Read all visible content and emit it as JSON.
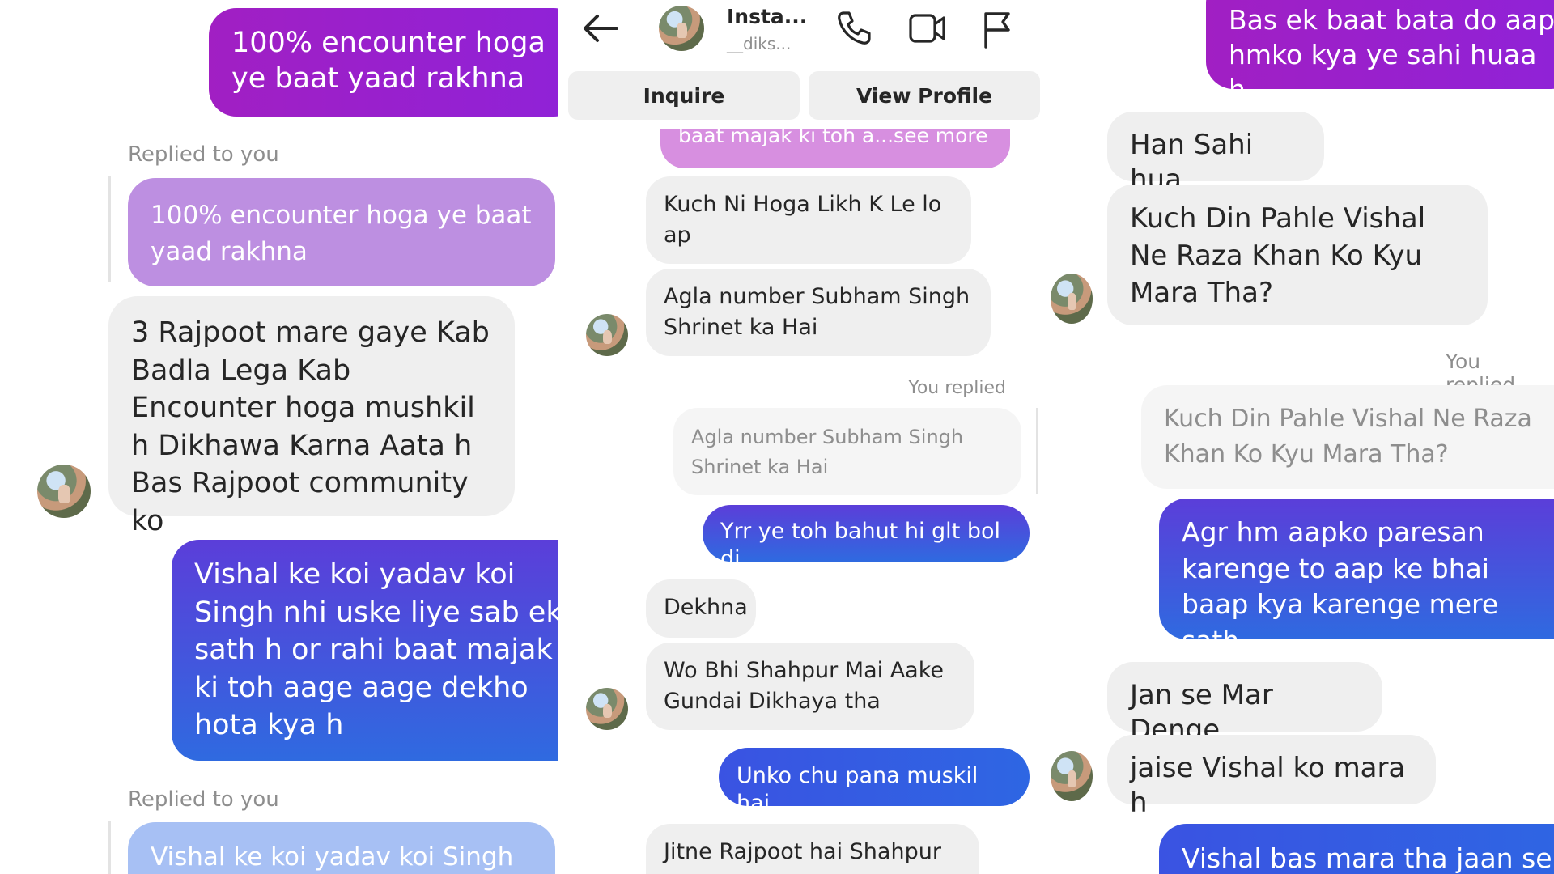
{
  "left": {
    "msg1": "100% encounter hoga ye baat yaad rakhna",
    "replied_label_1": "Replied to you",
    "quote1": "100% encounter hoga ye baat yaad rakhna",
    "msg2": "3 Rajpoot mare gaye Kab Badla Lega Kab Encounter hoga mushkil h Dikhawa Karna Aata h Bas Rajpoot community ko",
    "msg3": "Vishal ke koi yadav koi Singh nhi uske liye sab ek sath h or rahi baat majak ki toh aage aage dekho hota kya h",
    "replied_label_2": "Replied to you",
    "quote2": "Vishal ke koi yadav koi Singh nhi"
  },
  "header": {
    "name": "Insta...",
    "username": "__diks...",
    "inquire_label": "Inquire",
    "view_profile_label": "View Profile"
  },
  "mid": {
    "msg_partial": "baat majak ki toh a...see more",
    "msg1": "Kuch Ni Hoga Likh K Le lo ap",
    "msg2": "Agla number Subham Singh Shrinet ka Hai",
    "you_replied": "You replied",
    "quote": "Agla number Subham Singh Shrinet ka Hai",
    "reply1": "Yrr ye toh bahut hi glt bol di",
    "msg3": "Dekhna",
    "msg4": "Wo Bhi Shahpur Mai Aake Gundai Dikhaya tha",
    "reply2": "Unko chu pana muskil hai",
    "msg5": "Jitne Rajpoot hai Shahpur"
  },
  "right": {
    "msg_top": "Bas ek baat bata do aap hmko kya ye sahi huaa h",
    "msg1": "Han Sahi hua",
    "msg2": "Kuch Din Pahle Vishal Ne Raza Khan Ko Kyu Mara Tha?",
    "you_replied": "You replied",
    "quote": "Kuch Din Pahle Vishal Ne Raza Khan Ko Kyu Mara Tha?",
    "reply1": "Agr hm aapko paresan karenge to aap ke bhai baap kya karenge mere sath",
    "msg3": "Jan se Mar Denge",
    "msg4": "jaise Vishal ko mara h",
    "reply_bottom": "Vishal bas mara tha jaan se"
  },
  "icons": {
    "back": "arrow-left-icon",
    "call": "phone-icon",
    "video": "video-camera-icon",
    "report": "flag-icon"
  }
}
